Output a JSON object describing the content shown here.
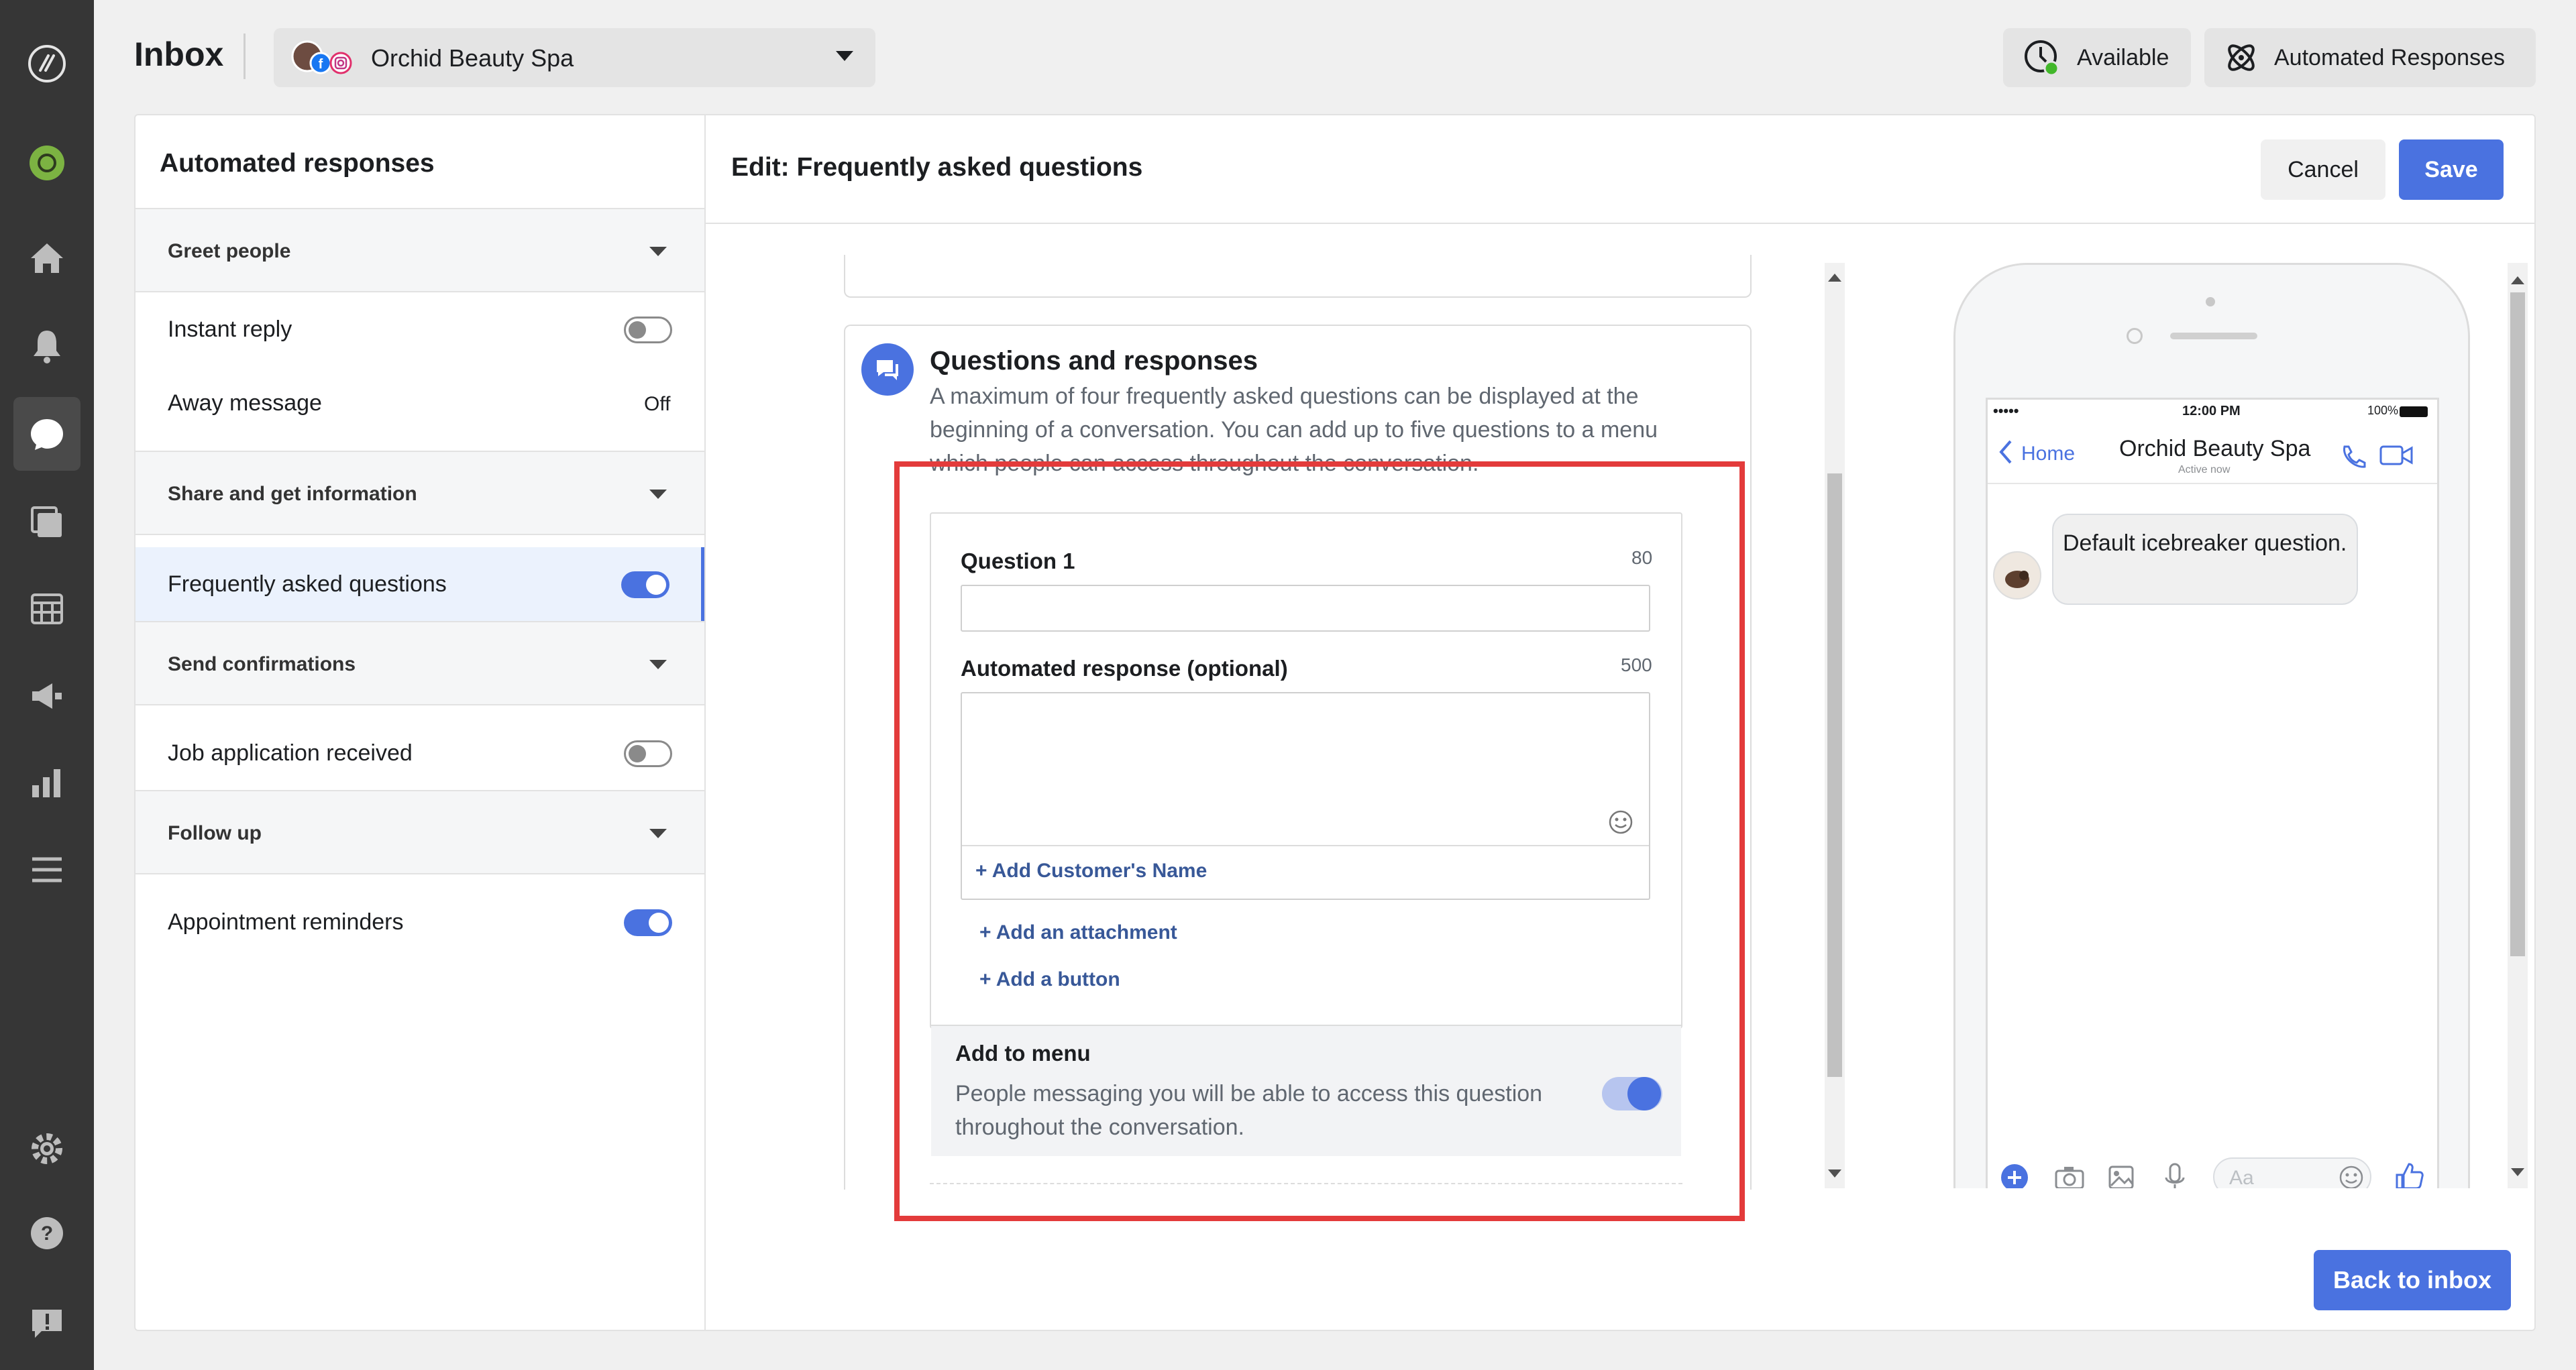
{
  "header": {
    "title": "Inbox",
    "page_name": "Orchid Beauty Spa",
    "available_label": "Available",
    "automated_label": "Automated Responses"
  },
  "sidebar_left": {
    "title": "Automated responses",
    "sections": [
      {
        "label": "Greet people",
        "items": [
          {
            "label": "Instant reply",
            "state": "off"
          },
          {
            "label": "Away message",
            "status": "Off"
          }
        ]
      },
      {
        "label": "Share and get information",
        "items": [
          {
            "label": "Frequently asked questions",
            "state": "on"
          }
        ]
      },
      {
        "label": "Send confirmations",
        "items": [
          {
            "label": "Job application received",
            "state": "off"
          }
        ]
      },
      {
        "label": "Follow up",
        "items": [
          {
            "label": "Appointment reminders",
            "state": "on"
          }
        ]
      }
    ]
  },
  "main": {
    "edit_title": "Edit: Frequently asked questions",
    "cancel_label": "Cancel",
    "save_label": "Save",
    "qr_title": "Questions and responses",
    "qr_desc": "A maximum of four frequently asked questions can be displayed at the beginning of a conversation. You can add up to five questions to a menu which people can access throughout the conversation.",
    "question_label": "Question 1",
    "question_count": "80",
    "response_label": "Automated response (optional)",
    "response_count": "500",
    "add_name_link": "+ Add Customer's Name",
    "add_attachment_link": "+ Add an attachment",
    "add_button_link": "+ Add a button",
    "add_menu_title": "Add to menu",
    "add_menu_desc": "People messaging you will be able to access this question throughout the conversation.",
    "add_menu_state": "on",
    "back_to_inbox": "Back to inbox"
  },
  "phone": {
    "signal": "•••••",
    "time": "12:00 PM",
    "battery": "100%",
    "back_label": "Home",
    "contact_name": "Orchid Beauty Spa",
    "contact_status": "Active now",
    "bubble_text": "Default icebreaker question.",
    "composer_placeholder": "Aa"
  },
  "colors": {
    "accent": "#4a72e0",
    "highlight": "#e33b3b",
    "rail": "#363636",
    "link": "#385898"
  }
}
